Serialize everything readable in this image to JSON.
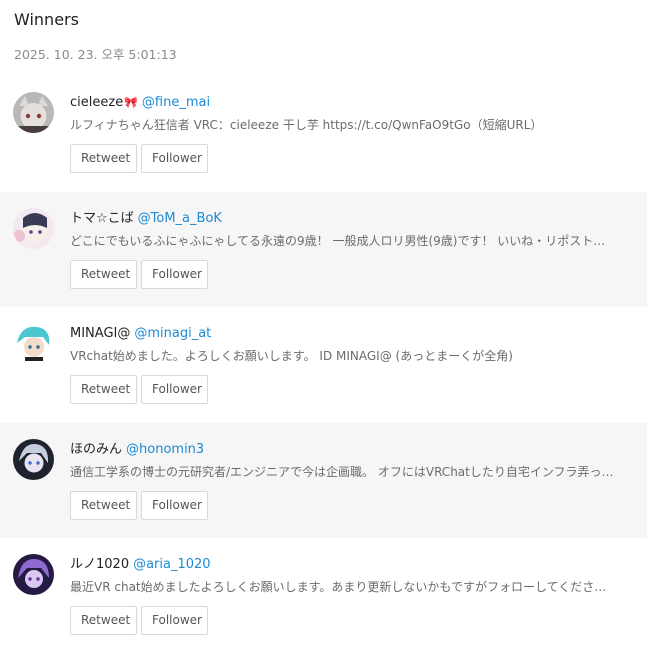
{
  "header": {
    "title": "Winners",
    "timestamp": "2025. 10. 23. 오후 5:01:13"
  },
  "buttons": {
    "retweet_label": "Retweet",
    "follower_label": "Follower"
  },
  "winners": [
    {
      "name": "cieleeze",
      "name_suffix_icon": "ribbon-icon",
      "handle": "@fine_mai",
      "bio": "ルフィナちゃん狂信者 VRC：cieleeze 干し芋 https://t.co/QwnFaO9tGo（短縮URL）",
      "avatar_colors": [
        "#cfcfcf",
        "#5a4a4a"
      ]
    },
    {
      "name": "トマ☆こば",
      "handle": "@ToM_a_BoK",
      "bio": "どこにでもいるふにゃふにゃしてる永遠の9歳！ 一般成人ロリ男性(9歳)です！ いいね・リポスト…",
      "avatar_colors": [
        "#f1e6f0",
        "#3b3b55"
      ]
    },
    {
      "name": "MINAGI@",
      "handle": "@minagi_at",
      "bio": "VRchat始めました。よろしくお願いします。 ID MINAGI@ (あっとまーくが全角)",
      "avatar_colors": [
        "#5fd0d8",
        "#f2d6c8"
      ]
    },
    {
      "name": "ほのみん",
      "handle": "@honomin3",
      "bio": "通信工学系の博士の元研究者/エンジニアで今は企画職。 オフにはVRChatしたり自宅インフラ弄っ…",
      "avatar_colors": [
        "#2b2f3a",
        "#c9d0e0"
      ]
    },
    {
      "name": "ルノ1020",
      "handle": "@aria_1020",
      "bio": "最近VR chat始めましたよろしくお願いします。あまり更新しないかもですがフォローしてくださ…",
      "avatar_colors": [
        "#2a1f4a",
        "#9a7ad6"
      ]
    }
  ]
}
